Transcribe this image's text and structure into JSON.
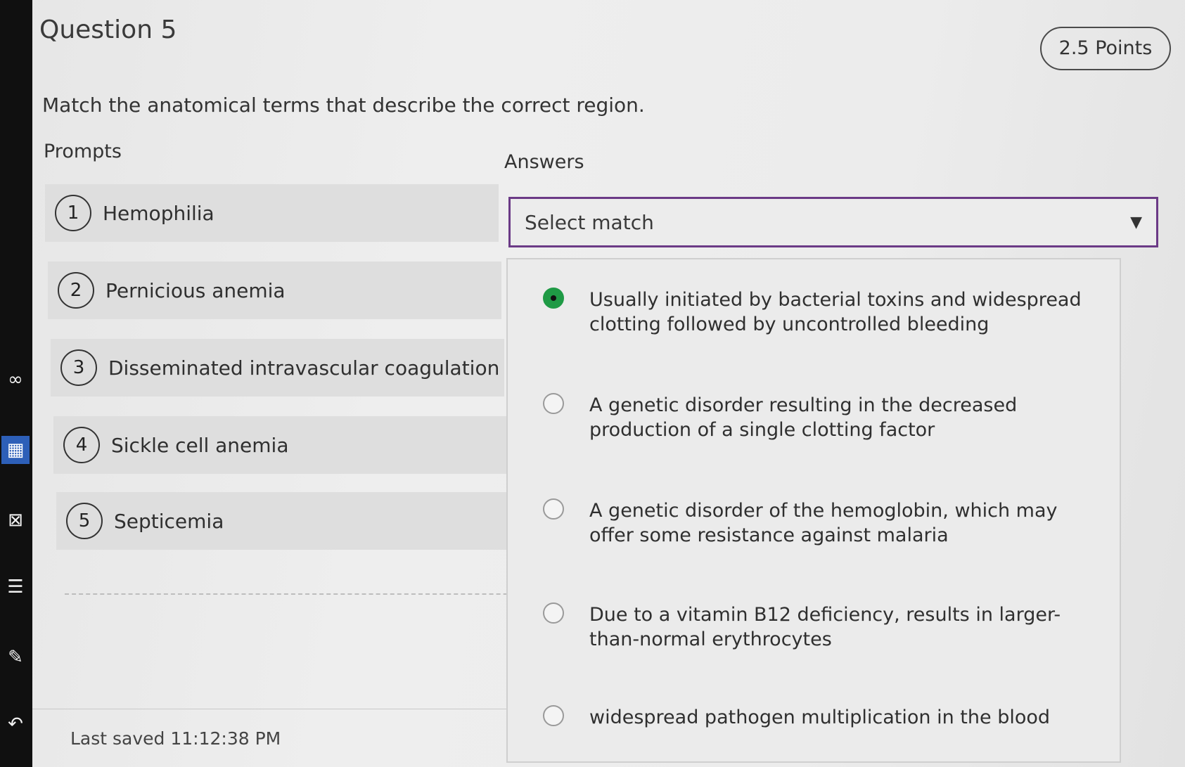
{
  "question": {
    "title": "Question 5",
    "points": "2.5 Points",
    "instruction": "Match the anatomical terms that describe the correct region."
  },
  "columns": {
    "prompts_heading": "Prompts",
    "answers_heading": "Answers"
  },
  "prompts": [
    {
      "number": "1",
      "label": "Hemophilia"
    },
    {
      "number": "2",
      "label": "Pernicious anemia"
    },
    {
      "number": "3",
      "label": "Disseminated intravascular coagulation"
    },
    {
      "number": "4",
      "label": "Sickle cell anemia"
    },
    {
      "number": "5",
      "label": "Septicemia"
    }
  ],
  "select": {
    "value": "Select match"
  },
  "options": [
    {
      "text": "Usually initiated by bacterial toxins and widespread clotting followed by uncontrolled bleeding",
      "selected": true
    },
    {
      "text": "A genetic disorder resulting in the decreased production of a single clotting factor",
      "selected": false
    },
    {
      "text": "A genetic disorder of the hemoglobin, which may offer some resistance against malaria",
      "selected": false
    },
    {
      "text": "Due to a vitamin B12 deficiency, results in larger-than-normal erythrocytes",
      "selected": false
    },
    {
      "text": "widespread pathogen multiplication in the blood",
      "selected": false
    }
  ],
  "footer": {
    "last_saved": "Last saved 11:12:38 PM"
  },
  "colors": {
    "select_border": "#6b3a86",
    "selected_radio": "#1f9a45"
  },
  "icons": [
    "undo-icon",
    "notes-icon",
    "list-icon",
    "calculator-icon",
    "eye-icon"
  ]
}
